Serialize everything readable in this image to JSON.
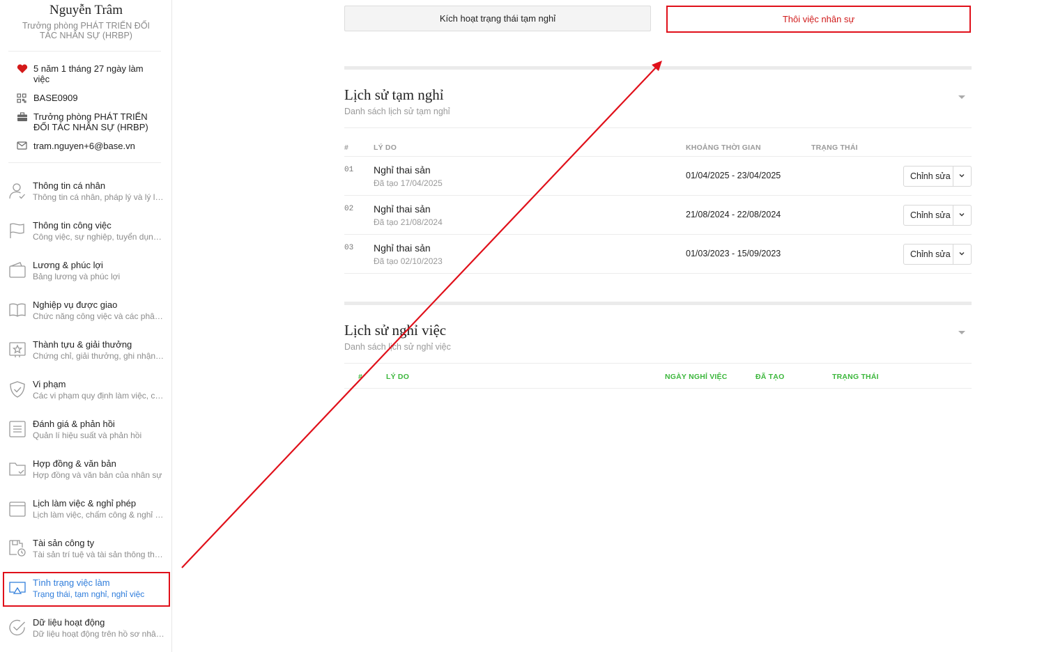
{
  "profile": {
    "name": "Nguyễn Trâm",
    "title": "Trưởng phòng PHÁT TRIỂN ĐỐI TÁC NHÂN SỰ (HRBP)",
    "tenure": "5 năm 1 tháng 27 ngày làm việc",
    "code": "BASE0909",
    "position": "Trưởng phòng PHÁT TRIỂN ĐỐI TÁC NHÂN SỰ (HRBP)",
    "email": "tram.nguyen+6@base.vn"
  },
  "nav": [
    {
      "title": "Thông tin cá nhân",
      "sub": "Thông tin cá nhân, pháp lý và lý lịch",
      "icon": "user-icon"
    },
    {
      "title": "Thông tin công việc",
      "sub": "Công việc, sự nghiệp, tuyển dụng và đào tạo",
      "icon": "flag-icon"
    },
    {
      "title": "Lương & phúc lợi",
      "sub": "Bảng lương và phúc lợi",
      "icon": "wallet-icon"
    },
    {
      "title": "Nghiệp vụ được giao",
      "sub": "Chức năng công việc và các phân quyền",
      "icon": "book-icon"
    },
    {
      "title": "Thành tựu & giải thưởng",
      "sub": "Chứng chỉ, giải thưởng, ghi nhận vinh danh",
      "icon": "star-icon"
    },
    {
      "title": "Vi phạm",
      "sub": "Các vi phạm quy định làm việc, chính sách",
      "icon": "shield-icon"
    },
    {
      "title": "Đánh giá & phản hồi",
      "sub": "Quản lí hiệu suất và phản hồi",
      "icon": "document-icon"
    },
    {
      "title": "Hợp đồng & văn bản",
      "sub": "Hợp đồng và văn bản của nhân sự",
      "icon": "folder-icon"
    },
    {
      "title": "Lịch làm việc & nghỉ phép",
      "sub": "Lịch làm việc, chấm công & nghỉ phép",
      "icon": "calendar-icon"
    },
    {
      "title": "Tài sản công ty",
      "sub": "Tài sản trí tuệ và tài sản thông thường",
      "icon": "asset-icon"
    },
    {
      "title": "Tình trạng việc làm",
      "sub": "Trạng thái, tạm nghỉ, nghỉ việc",
      "icon": "monitor-icon"
    },
    {
      "title": "Dữ liệu hoạt động",
      "sub": "Dữ liệu hoạt động trên hồ sơ nhân sự",
      "icon": "check-circle-icon"
    }
  ],
  "actions": {
    "suspend": "Kích hoạt trạng thái tạm nghỉ",
    "terminate": "Thôi việc nhân sự"
  },
  "leave_history": {
    "title": "Lịch sử tạm nghỉ",
    "subtitle": "Danh sách lịch sử tạm nghỉ",
    "columns": [
      "#",
      "LÝ DO",
      "KHOẢNG THỜI GIAN",
      "TRẠNG THÁI"
    ],
    "rows": [
      {
        "num": "01",
        "reason": "Nghỉ thai sản",
        "created": "Đã tạo 17/04/2025",
        "range": "01/04/2025 - 23/04/2025",
        "action": "Chỉnh sửa"
      },
      {
        "num": "02",
        "reason": "Nghỉ thai sản",
        "created": "Đã tạo 21/08/2024",
        "range": "21/08/2024 - 22/08/2024",
        "action": "Chỉnh sửa"
      },
      {
        "num": "03",
        "reason": "Nghỉ thai sản",
        "created": "Đã tạo 02/10/2023",
        "range": "01/03/2023 - 15/09/2023",
        "action": "Chỉnh sửa"
      }
    ]
  },
  "resign_history": {
    "title": "Lịch sử nghỉ việc",
    "subtitle": "Danh sách lịch sử nghỉ việc",
    "columns": [
      "#",
      "LÝ DO",
      "NGÀY NGHỈ VIỆC",
      "ĐÃ TẠO",
      "TRẠNG THÁI"
    ]
  },
  "colors": {
    "annotation_red": "#e0101a",
    "active_blue": "#2f7ddb",
    "header_green": "#3cb73c"
  }
}
